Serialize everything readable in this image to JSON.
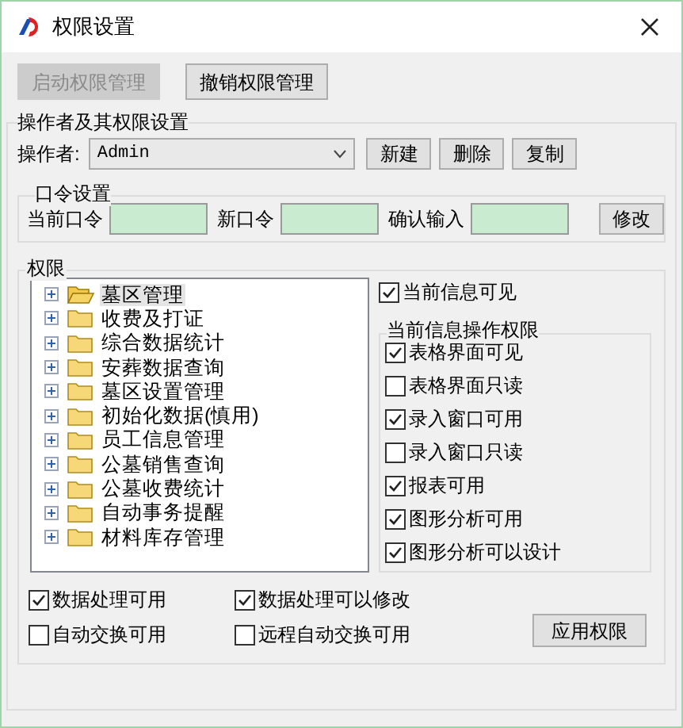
{
  "window": {
    "title": "权限设置"
  },
  "top_buttons": [
    {
      "label": "启动权限管理",
      "disabled": true
    },
    {
      "label": "撤销权限管理",
      "disabled": false
    }
  ],
  "operator_group": {
    "title": "操作者及其权限设置",
    "operator_label": "操作者:",
    "operator_value": "Admin",
    "buttons": [
      "新建",
      "删除",
      "复制"
    ]
  },
  "password_group": {
    "title": "口令设置",
    "fields": [
      {
        "label": "当前口令"
      },
      {
        "label": "新口令"
      },
      {
        "label": "确认输入"
      }
    ],
    "button": "修改"
  },
  "permissions_group": {
    "title": "权限",
    "tree": [
      {
        "label": "墓区管理",
        "selected": true
      },
      {
        "label": "收费及打证",
        "selected": false
      },
      {
        "label": "综合数据统计",
        "selected": false
      },
      {
        "label": "安葬数据查询",
        "selected": false
      },
      {
        "label": "墓区设置管理",
        "selected": false
      },
      {
        "label": "初始化数据(慎用)",
        "selected": false
      },
      {
        "label": "员工信息管理",
        "selected": false
      },
      {
        "label": "公墓销售查询",
        "selected": false
      },
      {
        "label": "公墓收费统计",
        "selected": false
      },
      {
        "label": "自动事务提醒",
        "selected": false
      },
      {
        "label": "材料库存管理",
        "selected": false
      }
    ],
    "visible": {
      "label": "当前信息可见",
      "checked": true
    },
    "operations_title": "当前信息操作权限",
    "operations": [
      {
        "label": "表格界面可见",
        "checked": true
      },
      {
        "label": "表格界面只读",
        "checked": false
      },
      {
        "label": "录入窗口可用",
        "checked": true
      },
      {
        "label": "录入窗口只读",
        "checked": false
      },
      {
        "label": "报表可用",
        "checked": true
      },
      {
        "label": "图形分析可用",
        "checked": true
      },
      {
        "label": "图形分析可以设计",
        "checked": true
      }
    ]
  },
  "bottom_options": [
    {
      "label": "数据处理可用",
      "checked": true
    },
    {
      "label": "数据处理可以修改",
      "checked": true
    },
    {
      "label": "自动交换可用",
      "checked": false
    },
    {
      "label": "远程自动交换可用",
      "checked": false
    }
  ],
  "apply_button": "应用权限"
}
